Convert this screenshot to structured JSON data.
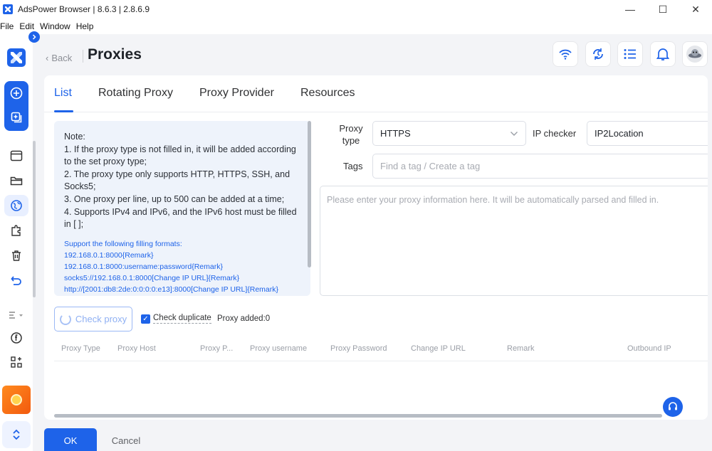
{
  "window": {
    "title": "AdsPower Browser | 8.6.3 | 2.8.6.9",
    "minimize": "—",
    "maximize": "☐",
    "close": "✕"
  },
  "menu": [
    "File",
    "Edit",
    "Window",
    "Help"
  ],
  "header": {
    "back_label": "Back",
    "title": "Proxies",
    "buttons": [
      "wifi-icon",
      "sync-icon",
      "list-icon",
      "bell-icon",
      "avatar-icon"
    ]
  },
  "tabs": [
    {
      "label": "List",
      "active": true
    },
    {
      "label": "Rotating Proxy",
      "active": false
    },
    {
      "label": "Proxy Provider",
      "active": false
    },
    {
      "label": "Resources",
      "active": false
    }
  ],
  "note": {
    "lines": [
      "Note:",
      "1. If the proxy type is not filled in, it will be added according to the set proxy type;",
      "2. The proxy type only supports HTTP, HTTPS, SSH, and Socks5;",
      "3. One proxy per line, up to 500 can be added at a time;",
      "4. Supports IPv4 and IPv6, and the IPv6 host must be filled in [ ];"
    ],
    "formats_title": "Support the following filling formats:",
    "formats": [
      "192.168.0.1:8000{Remark}",
      "192.168.0.1:8000:username:password{Remark}",
      "socks5://192.168.0.1:8000[Change IP URL]{Remark}",
      "http://[2001:db8:2de:0:0:0:0:e13]:8000[Change IP URL]{Remark}"
    ]
  },
  "form": {
    "proxy_type_label_1": "Proxy",
    "proxy_type_label_2": "type",
    "proxy_type_value": "HTTPS",
    "ip_checker_label": "IP checker",
    "ip_checker_value": "IP2Location",
    "tags_label": "Tags",
    "tags_placeholder": "Find a tag / Create a tag",
    "textarea_placeholder": "Please enter your proxy information here. It will be automatically parsed and filled in."
  },
  "actions": {
    "check_proxy": "Check proxy",
    "check_duplicate": "Check duplicate",
    "check_duplicate_checked": true,
    "proxy_added": "Proxy added:0"
  },
  "table": {
    "columns": [
      "Proxy Type",
      "Proxy Host",
      "Proxy P...",
      "Proxy username",
      "Proxy Password",
      "Change IP URL",
      "Remark",
      "Outbound IP"
    ]
  },
  "footer": {
    "ok": "OK",
    "cancel": "Cancel"
  },
  "colors": {
    "accent": "#1e63e9",
    "orange": "#f25a0e"
  }
}
